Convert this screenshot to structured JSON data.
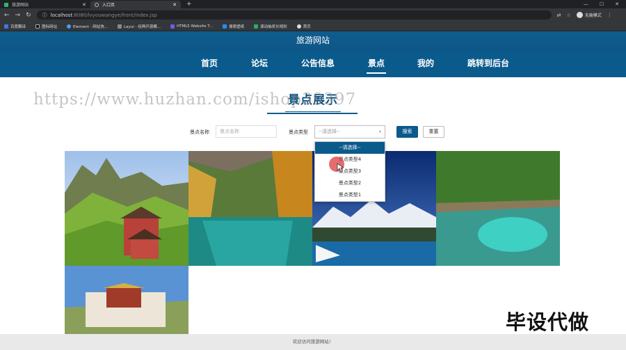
{
  "browser": {
    "tabs": [
      {
        "title": "旅游网站",
        "active": false
      },
      {
        "title": "入口页",
        "active": true
      }
    ],
    "url_host": "localhost",
    "url_rest": ":8080/lvyouwangye/front/index.jsp",
    "profile": "无痕模式",
    "bookmarks": [
      "百度翻译",
      "图标网站",
      "Element - 网站快...",
      "Layui - 经典开源模...",
      "HTML5 Website T...",
      "搜索壁纸",
      "滚动抽奖长规则",
      "首页"
    ]
  },
  "site": {
    "title": "旅游网站",
    "nav": [
      "首页",
      "论坛",
      "公告信息",
      "景点",
      "我的",
      "跳转到后台"
    ],
    "active_nav": "景点"
  },
  "section": {
    "title": "景点展示"
  },
  "watermark": "https://www.huzhan.com/ishop39397",
  "search": {
    "name_label": "景点名称",
    "name_placeholder": "景点名称",
    "type_label": "景点类型",
    "type_value": "--请选择--",
    "search_btn": "搜索",
    "reset_btn": "重置"
  },
  "dropdown": {
    "options": [
      "--请选择--",
      "景点类型4",
      "景点类型3",
      "景点类型2",
      "景点类型1"
    ],
    "selected_index": 0
  },
  "stamp": "毕设代做",
  "footer": "欢迎访问旅游网站！",
  "colors": {
    "primary": "#0b5a8c",
    "header": "#0f5c8e"
  }
}
